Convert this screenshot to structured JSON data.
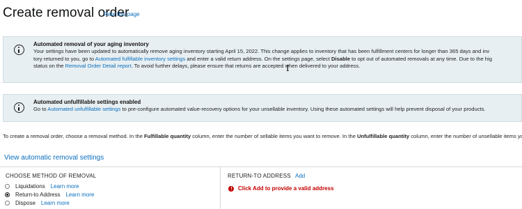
{
  "page": {
    "title": "Create removal order",
    "rate_link": "Rate this page"
  },
  "alert_aging": {
    "heading": "Automated removal of your aging inventory",
    "line1": "Your settings have been updated to automatically remove aging inventory starting April 15, 2022. This change applies to inventory that has been fulfillment centers for longer than 365 days and inv",
    "line2_a": "tory returned to you, go to ",
    "line2_link": "Automated fulfillable inventory settings",
    "line2_b": " and enter a valid return address. On the settings page, select ",
    "line2_bold": "Disable",
    "line2_c": " to opt out of automated removals at any time. Due to the hig",
    "line3_a": "status on the ",
    "line3_link": "Removal Order Detail report",
    "line3_b": ". To avoid further delays, please ensure that returns are accepted when delivered to your address."
  },
  "alert_unfulfillable": {
    "heading": "Automated unfulfillable settings enabled",
    "text_a": "Go to ",
    "link": "Automated unfulfillable settings",
    "text_b": " to pre-configure automated value-recovery options for your unsellable inventory. Using these automated settings will help prevent disposal of your products."
  },
  "instructions": {
    "part1": "To create a removal order, choose a removal method. In the ",
    "bold1": "Fulfillable quantity",
    "part2": " column, enter the number of sellable items you want to remove. In the ",
    "bold2": "Unfulfillable quantity",
    "part3": " column, enter the number of unsellable items you"
  },
  "auto_link": "View automatic removal settings",
  "method": {
    "heading": "CHOOSE METHOD OF REMOVAL",
    "options": [
      {
        "label": "Liquidations",
        "learn": "Learn more",
        "selected": false
      },
      {
        "label": "Return-to Address",
        "learn": "Learn more",
        "selected": true
      },
      {
        "label": "Dispose",
        "learn": "Learn more",
        "selected": false
      }
    ]
  },
  "return_address": {
    "heading": "RETURN-TO ADDRESS",
    "add_label": "Add",
    "error_prefix": "Click ",
    "error_add": "Add",
    "error_suffix": " to provide a valid address"
  },
  "colors": {
    "link": "#0a6ebd",
    "alert_bg": "#e8eff2",
    "error": "#c40000"
  },
  "icons": [
    "info-icon",
    "info-icon",
    "error-icon",
    "text-cursor-icon"
  ]
}
